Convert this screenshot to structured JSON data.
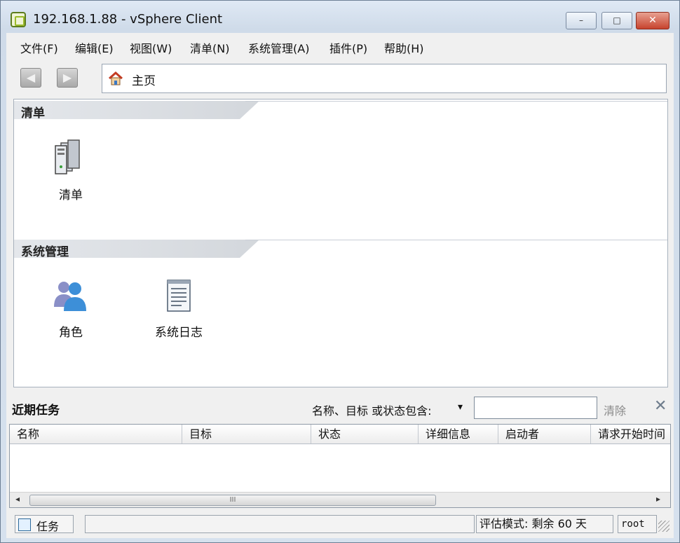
{
  "window": {
    "title": "192.168.1.88 - vSphere Client",
    "controls": {
      "minimize": "–",
      "maximize": "□",
      "close": "✕"
    }
  },
  "menu": {
    "items": [
      "文件(F)",
      "编辑(E)",
      "视图(W)",
      "清单(N)",
      "系统管理(A)",
      "插件(P)",
      "帮助(H)"
    ]
  },
  "toolbar": {
    "back_icon": "◀",
    "forward_icon": "▶",
    "address": "主页"
  },
  "sections": [
    {
      "title": "清单",
      "items": [
        {
          "label": "清单",
          "icon": "servers-icon"
        }
      ]
    },
    {
      "title": "系统管理",
      "items": [
        {
          "label": "角色",
          "icon": "roles-icon"
        },
        {
          "label": "系统日志",
          "icon": "log-icon"
        }
      ]
    }
  ],
  "recent_tasks": {
    "title": "近期任务",
    "filter_label": "名称、目标 或状态包含:",
    "filter_dropdown": "▾",
    "filter_value": "",
    "clear_label": "清除",
    "close_icon": "✕",
    "columns": [
      "名称",
      "目标",
      "状态",
      "详细信息",
      "启动者",
      "请求开始时间"
    ],
    "rows": [],
    "scroll": {
      "left": "◂",
      "right": "▸",
      "thumb": "III"
    }
  },
  "statusbar": {
    "tasks_label": "任务",
    "evaluation": "评估模式: 剩余 60 天",
    "user": "root"
  }
}
